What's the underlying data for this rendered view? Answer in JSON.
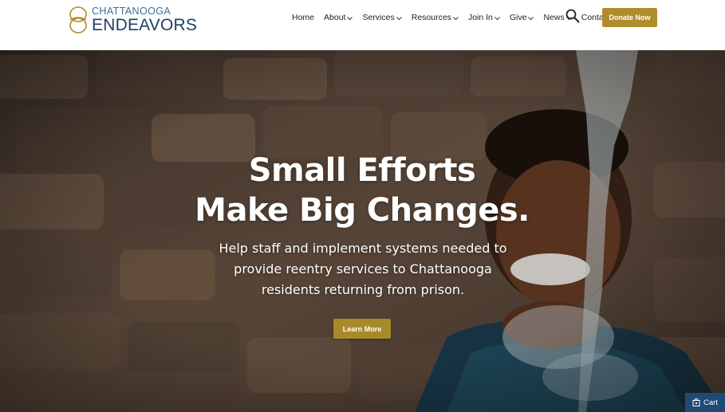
{
  "brand": {
    "line1": "CHATTANOOGA",
    "line2": "ENDEAVORS",
    "mark_icon": "interlocking-rings-logo"
  },
  "nav": {
    "items": [
      {
        "label": "Home",
        "has_dropdown": false
      },
      {
        "label": "About",
        "has_dropdown": true
      },
      {
        "label": "Services",
        "has_dropdown": true
      },
      {
        "label": "Resources",
        "has_dropdown": true
      },
      {
        "label": "Join In",
        "has_dropdown": true
      },
      {
        "label": "Give",
        "has_dropdown": true
      },
      {
        "label": "News",
        "has_dropdown": true
      },
      {
        "label": "Contact",
        "has_dropdown": false
      }
    ],
    "search_icon": "search-icon",
    "donate_label": "Donate Now"
  },
  "hero": {
    "headline_line1": "Small Efforts",
    "headline_line2": "Make Big Changes.",
    "subtext_line1": "Help staff and implement systems needed to",
    "subtext_line2": "provide reentry services to Chattanooga",
    "subtext_line3": "residents returning from prison.",
    "cta_label": "Learn More"
  },
  "cart": {
    "label": "Cart",
    "icon": "cart-icon"
  },
  "colors": {
    "accent_gold": "#b08d2c",
    "brand_navy": "#1f3f66",
    "cart_blue": "#1f4a73"
  }
}
